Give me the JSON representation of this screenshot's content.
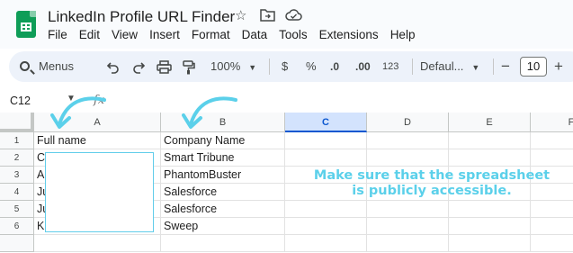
{
  "app": {
    "doc_title": "LinkedIn Profile URL Finder",
    "icons": [
      "star-icon",
      "move-folder-icon",
      "cloud-status-icon"
    ]
  },
  "menubar": {
    "items": [
      "File",
      "Edit",
      "View",
      "Insert",
      "Format",
      "Data",
      "Tools",
      "Extensions",
      "Help"
    ]
  },
  "toolbar": {
    "search_label": "Menus",
    "zoom": "100%",
    "currency": "$",
    "percent": "%",
    "decrease_decimals": ".0",
    "increase_decimals": ".00",
    "number_format": "123",
    "font_name": "Defaul...",
    "font_decrease": "−",
    "font_size": "10",
    "font_increase": "+"
  },
  "formula_bar": {
    "name_box": "C12",
    "fx": "fx"
  },
  "sheet": {
    "columns": [
      "A",
      "B",
      "C",
      "D",
      "E",
      "F"
    ],
    "active_column": "C",
    "rows": [
      {
        "num": "1",
        "a": "Full name",
        "b": "Company Name"
      },
      {
        "num": "2",
        "a": "C",
        "b": "Smart Tribune"
      },
      {
        "num": "3",
        "a": "A",
        "b": "PhantomBuster"
      },
      {
        "num": "4",
        "a": "Ju",
        "b": "Salesforce"
      },
      {
        "num": "5",
        "a": "Ju",
        "b": "Salesforce"
      },
      {
        "num": "6",
        "a": "K",
        "b": "Sweep"
      }
    ]
  },
  "annotation": {
    "line1": "Make sure that the spreadsheet",
    "line2": "is publicly accessible.",
    "color": "#5bd0ea"
  }
}
